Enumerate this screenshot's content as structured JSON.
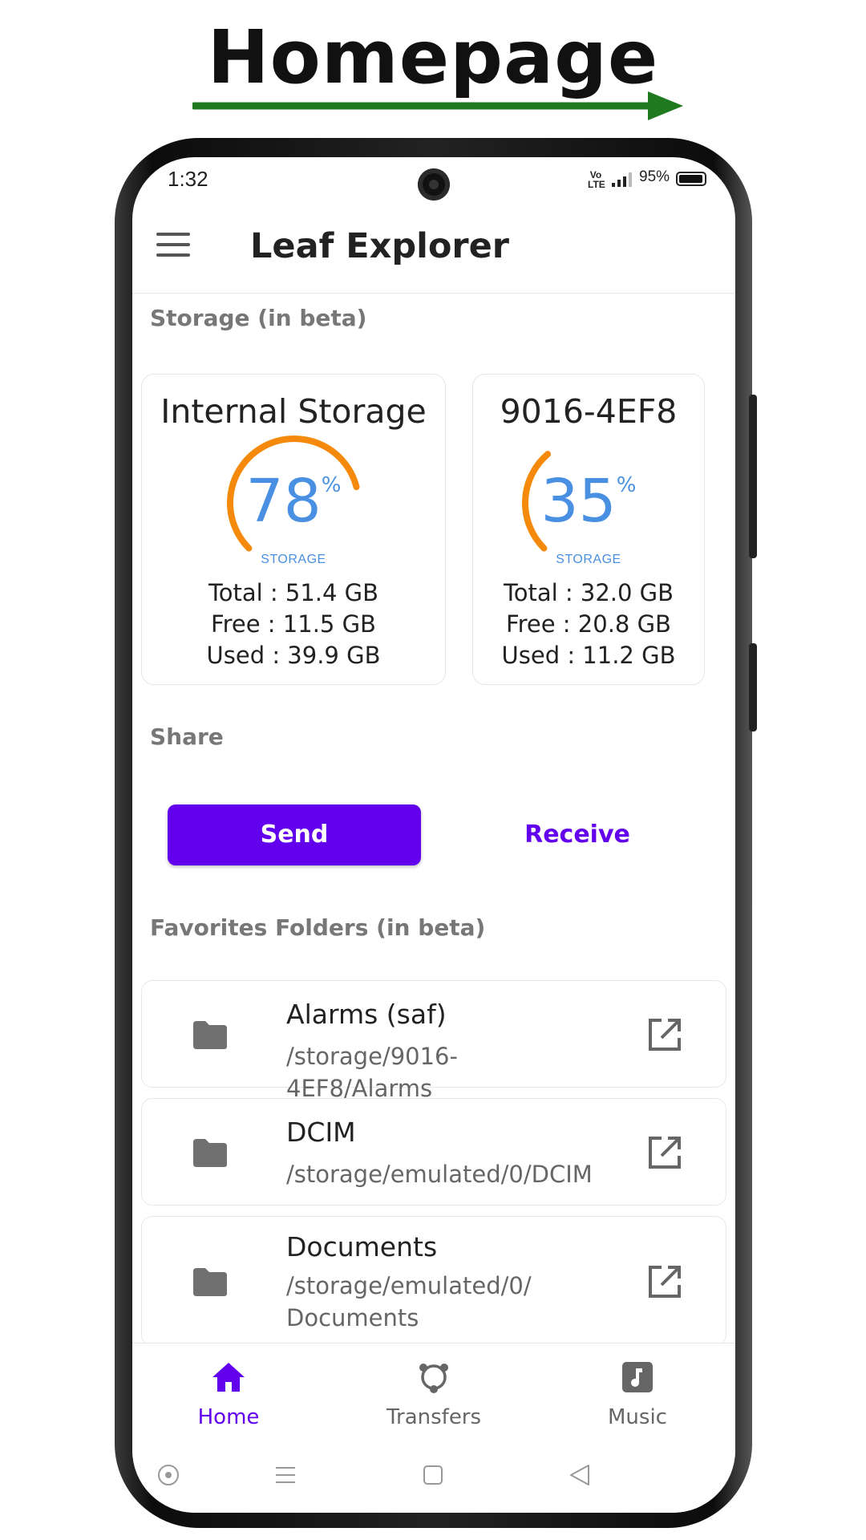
{
  "banner": {
    "title": "Homepage"
  },
  "colors": {
    "accent": "#6200ee",
    "gauge_arc": "#f5890b",
    "gauge_text": "#4a90e2",
    "arrow": "#1f7a1f"
  },
  "status_bar": {
    "time": "1:32",
    "network": "Vo LTE",
    "battery": "95%"
  },
  "app_bar": {
    "title": "Leaf Explorer",
    "menu_icon": "hamburger-menu-icon"
  },
  "storage": {
    "section_label": "Storage (in beta)",
    "cards": [
      {
        "name": "Internal Storage",
        "percent": "78",
        "percent_sign": "%",
        "sub_label": "STORAGE",
        "total": "Total : 51.4 GB",
        "free": "Free : 11.5 GB",
        "used": "Used : 39.9 GB",
        "fraction": 0.78
      },
      {
        "name": "9016-4EF8",
        "percent": "35",
        "percent_sign": "%",
        "sub_label": "STORAGE",
        "total": "Total : 32.0 GB",
        "free": "Free : 20.8 GB",
        "used": "Used : 11.2 GB",
        "fraction": 0.35
      }
    ]
  },
  "share": {
    "section_label": "Share",
    "send_label": "Send",
    "receive_label": "Receive"
  },
  "favorites": {
    "section_label": "Favorites Folders (in beta)",
    "items": [
      {
        "name": "Alarms (saf)",
        "path": "/storage/9016-4EF8/Alarms",
        "icon": "folder-icon",
        "action_icon": "open-external-icon"
      },
      {
        "name": "DCIM",
        "path": "/storage/emulated/0/DCIM",
        "icon": "folder-icon",
        "action_icon": "open-external-icon"
      },
      {
        "name": "Documents",
        "path": "/storage/emulated/0/",
        "path_line2": "Documents",
        "icon": "folder-icon",
        "action_icon": "open-external-icon"
      }
    ]
  },
  "bottom_nav": {
    "items": [
      {
        "label": "Home",
        "icon": "home-icon",
        "active": true
      },
      {
        "label": "Transfers",
        "icon": "transfers-icon",
        "active": false
      },
      {
        "label": "Music",
        "icon": "music-icon",
        "active": false
      }
    ]
  },
  "system_nav": {
    "icons": [
      "assistant-icon",
      "recents-menu-icon",
      "home-square-icon",
      "back-triangle-icon"
    ]
  }
}
